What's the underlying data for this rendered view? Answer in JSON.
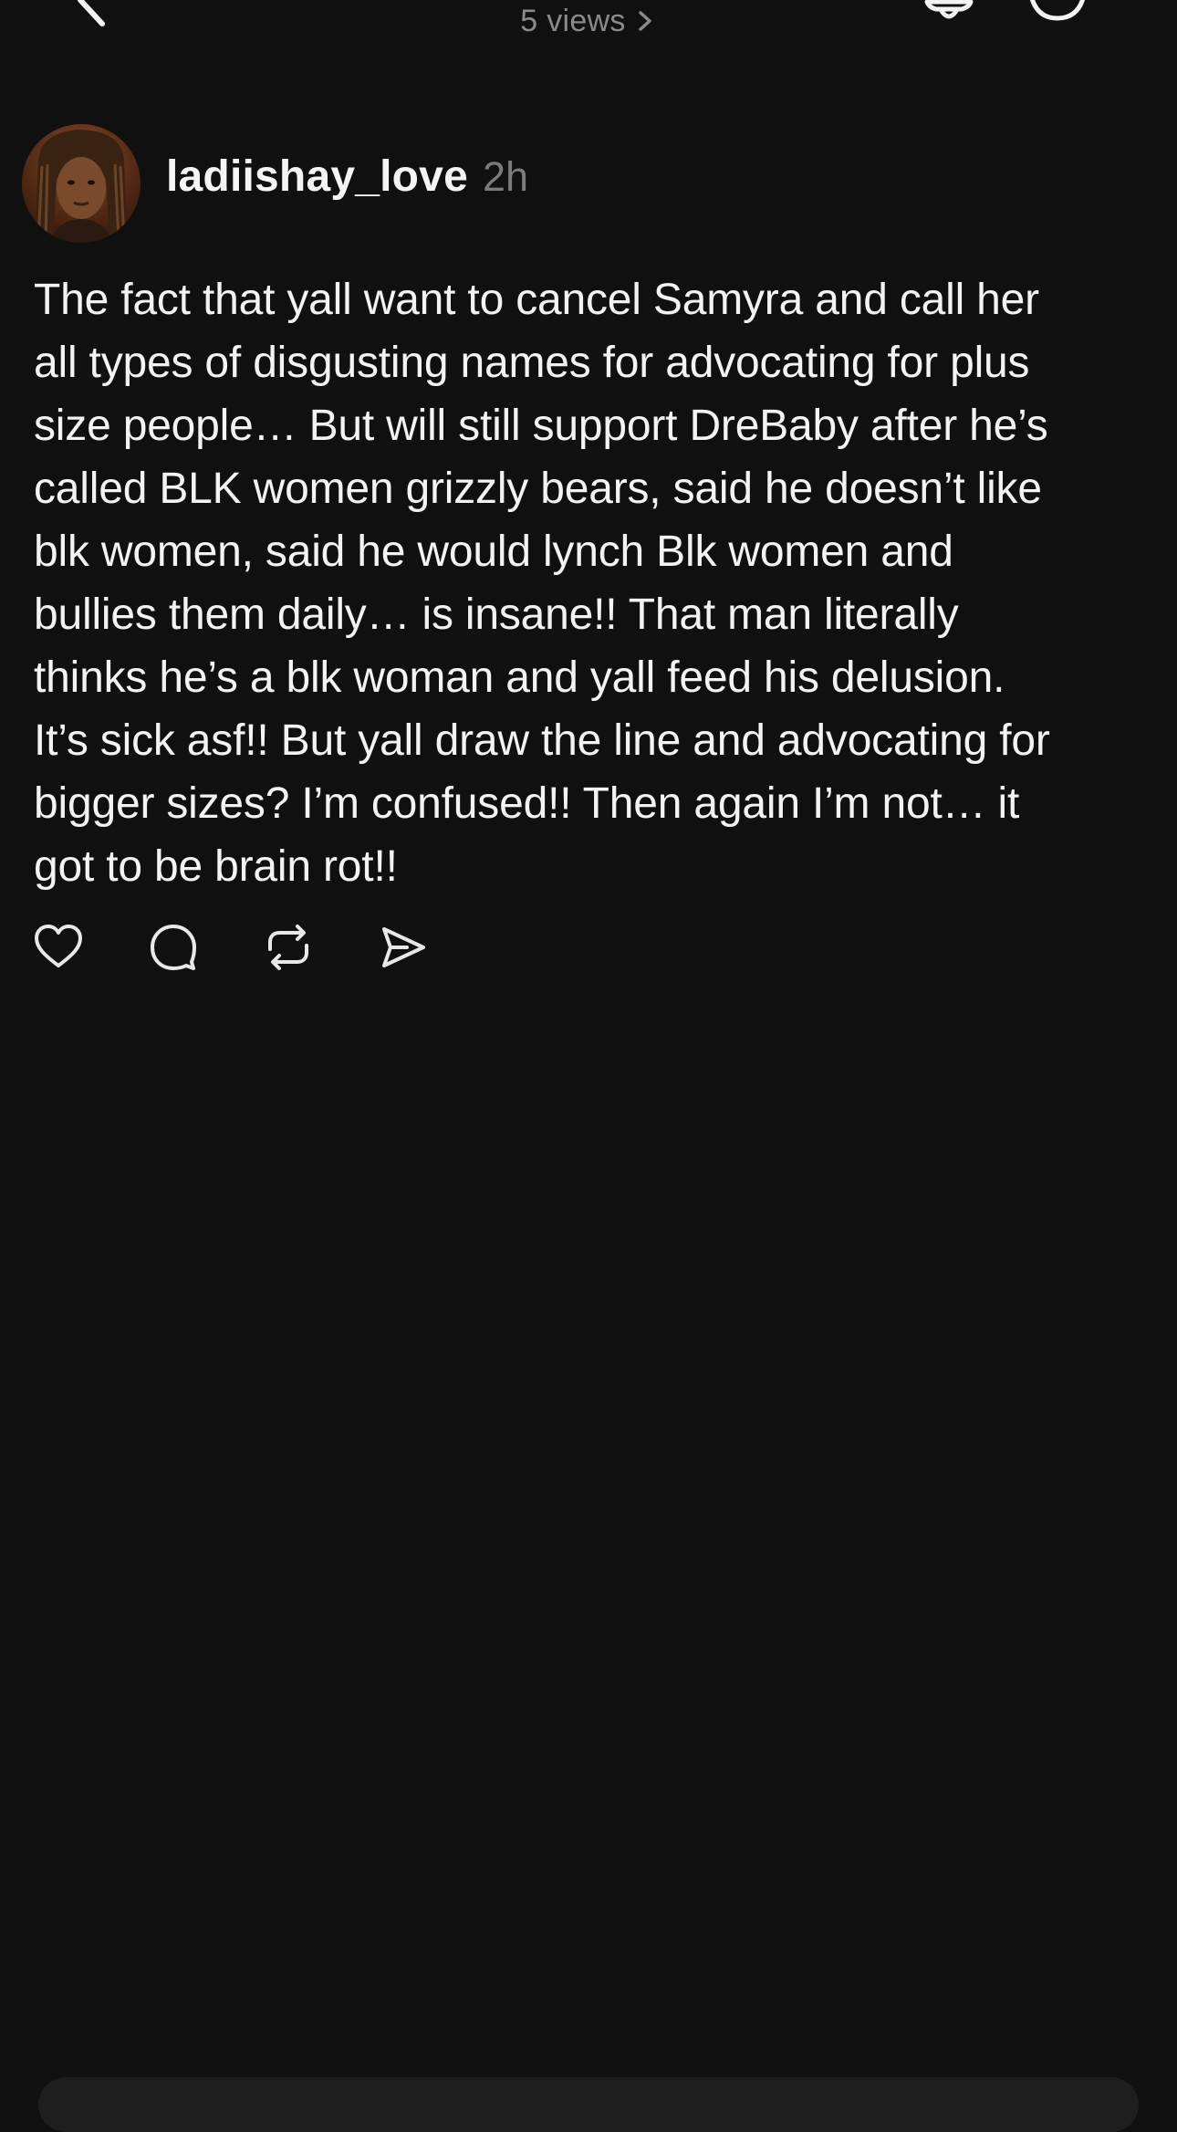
{
  "header": {
    "views_label": "5 views",
    "back_icon": "chevron-left-icon",
    "bell_icon": "bell-icon",
    "more_icon": "more-circle-icon"
  },
  "post": {
    "username": "ladiishay_love",
    "timestamp": "2h",
    "text": "The fact that yall want to cancel Samyra and call her\nall types of disgusting names for advocating for plus\nsize people… But will still support DreBaby after he’s\ncalled BLK women grizzly bears, said he doesn’t like\nblk women, said he would lynch Blk women and\nbullies them daily… is insane!! That man literally\nthinks he’s a blk woman and yall feed his delusion.\nIt’s sick asf!! But yall draw the line and advocating for\nbigger sizes? I’m confused!! Then again I’m not… it\ngot to be brain rot!!",
    "actions": [
      "heart-icon",
      "comment-icon",
      "repost-icon",
      "share-icon"
    ]
  },
  "colors": {
    "background": "#101010",
    "text": "#f3f3f3",
    "muted": "#7b7b7b"
  }
}
